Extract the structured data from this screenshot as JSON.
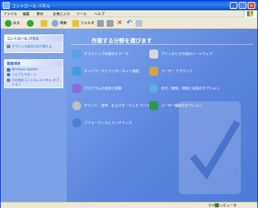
{
  "window": {
    "title": "コントロール パネル",
    "controls": [
      "_",
      "□",
      "×"
    ]
  },
  "menu": [
    "ファイル",
    "編集",
    "表示",
    "お気に入り",
    "ツール",
    "ヘルプ"
  ],
  "toolbar": {
    "back": "戻る",
    "search": "検索",
    "folders": "フォルダ"
  },
  "left_pane": {
    "control_panel_card": {
      "header": "コントロール パネル",
      "items": [
        "クラシック表示に切り替える"
      ]
    },
    "see_also_card": {
      "header": "関連項目",
      "items": [
        "Windows Update",
        "ヘルプとサポート",
        "その他のコントロールパネル オプション"
      ]
    }
  },
  "main": {
    "heading": "作業する分野を選びます",
    "categories": [
      {
        "label": "デスクトップの表示とテーマ",
        "icon": "display-icon",
        "color": "#5aa0e8"
      },
      {
        "label": "プリンタとその他のハードウェア",
        "icon": "printer-icon",
        "color": "#d8d8d8"
      },
      {
        "label": "ネットワークとインターネット接続",
        "icon": "network-icon",
        "color": "#3fa0d8"
      },
      {
        "label": "ユーザー アカウント",
        "icon": "users-icon",
        "color": "#e0a040"
      },
      {
        "label": "プログラムの追加と削除",
        "icon": "programs-icon",
        "color": "#8a6ad8"
      },
      {
        "label": "日付、時刻、地域と言語のオプション",
        "icon": "globe-icon",
        "color": "#5ab0e0"
      },
      {
        "label": "サウンド、音声、およびオーディオ デバイス",
        "icon": "sound-icon",
        "color": "#c0c0c0"
      },
      {
        "label": "ユーザー補助のオプション",
        "icon": "accessibility-icon",
        "color": "#2d9a4a"
      },
      {
        "label": "パフォーマンスとメンテナンス",
        "icon": "performance-icon",
        "color": "#4a80d0"
      }
    ]
  },
  "status": {
    "text": "マイ コンピュータ"
  }
}
